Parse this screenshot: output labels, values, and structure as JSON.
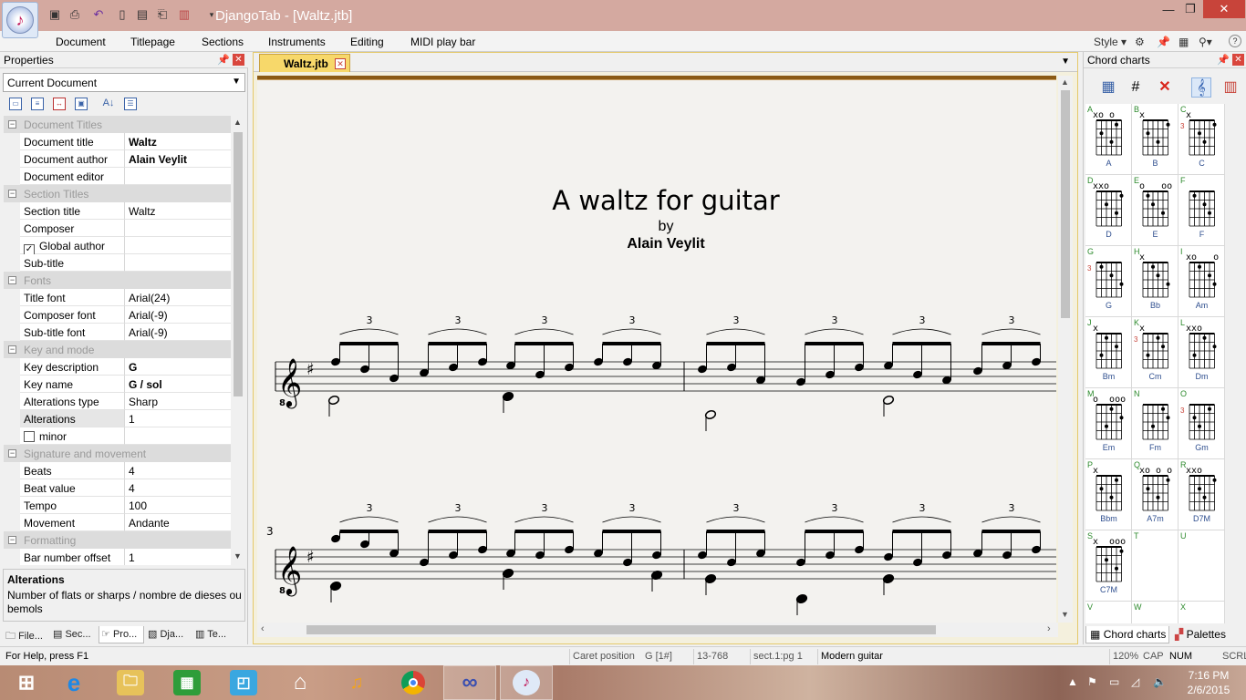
{
  "window": {
    "title": "DjangoTab - [Waltz.jtb]",
    "minimize": "—",
    "restore": "❐",
    "close": "✕"
  },
  "menu": {
    "items": [
      "Document",
      "Titlepage",
      "Sections",
      "Instruments",
      "Editing",
      "MIDI play bar"
    ],
    "style_label": "Style"
  },
  "properties": {
    "title": "Properties",
    "selector_value": "Current Document",
    "categories": {
      "document_titles": "Document Titles",
      "section_titles": "Section Titles",
      "fonts": "Fonts",
      "key_and_mode": "Key and mode",
      "signature": "Signature and movement",
      "formatting": "Formatting"
    },
    "rows": {
      "document_title": {
        "name": "Document title",
        "value": "Waltz"
      },
      "document_author": {
        "name": "Document author",
        "value": "Alain Veylit"
      },
      "document_editor": {
        "name": "Document editor",
        "value": ""
      },
      "section_title": {
        "name": "Section title",
        "value": "Waltz"
      },
      "composer": {
        "name": "Composer",
        "value": ""
      },
      "global_author": {
        "name": "Global author",
        "value": "",
        "checked": true
      },
      "sub_title": {
        "name": "Sub-title",
        "value": ""
      },
      "title_font": {
        "name": "Title font",
        "value": "Arial(24)"
      },
      "composer_font": {
        "name": "Composer font",
        "value": "Arial(-9)"
      },
      "sub_title_font": {
        "name": "Sub-title font",
        "value": "Arial(-9)"
      },
      "key_description": {
        "name": "Key description",
        "value": "G"
      },
      "key_name": {
        "name": "Key name",
        "value": "G / sol"
      },
      "alterations_type": {
        "name": "Alterations type",
        "value": "Sharp"
      },
      "alterations": {
        "name": "Alterations",
        "value": "1"
      },
      "minor": {
        "name": "minor",
        "value": "",
        "checked": false
      },
      "beats": {
        "name": "Beats",
        "value": "4"
      },
      "beat_value": {
        "name": "Beat value",
        "value": "4"
      },
      "tempo": {
        "name": "Tempo",
        "value": "100"
      },
      "movement": {
        "name": "Movement",
        "value": "Andante"
      },
      "bar_number_offset": {
        "name": "Bar number offset",
        "value": "1"
      }
    },
    "help": {
      "title": "Alterations",
      "text": "Number of flats or sharps / nombre de dieses ou bemols"
    },
    "bottom_tabs": [
      "File...",
      "Sec...",
      "Pro...",
      "Dja...",
      "Te..."
    ]
  },
  "document": {
    "tab_label": "Waltz.jtb",
    "score_title": "A waltz for guitar",
    "score_by": "by",
    "score_author": "Alain Veylit",
    "triplet_label": "3",
    "clef_octave": "8",
    "measure_number_2": "3"
  },
  "chords": {
    "title": "Chord charts",
    "cells": [
      {
        "letter": "A",
        "name": "A",
        "top": "xo o"
      },
      {
        "letter": "B",
        "name": "B",
        "top": "x"
      },
      {
        "letter": "C",
        "name": "C",
        "top": "x",
        "fret": "3"
      },
      {
        "letter": "D",
        "name": "D",
        "top": "xxo"
      },
      {
        "letter": "E",
        "name": "E",
        "top": "o   oo"
      },
      {
        "letter": "F",
        "name": "F",
        "top": ""
      },
      {
        "letter": "G",
        "name": "G",
        "top": "",
        "fret": "3"
      },
      {
        "letter": "H",
        "name": "Bb",
        "top": "x"
      },
      {
        "letter": "I",
        "name": "Am",
        "top": "xo   o"
      },
      {
        "letter": "J",
        "name": "Bm",
        "top": "x"
      },
      {
        "letter": "K",
        "name": "Cm",
        "top": "x",
        "fret": "3"
      },
      {
        "letter": "L",
        "name": "Dm",
        "top": "xxo"
      },
      {
        "letter": "M",
        "name": "Em",
        "top": "o  ooo"
      },
      {
        "letter": "N",
        "name": "Fm",
        "top": ""
      },
      {
        "letter": "O",
        "name": "Gm",
        "top": "",
        "fret": "3"
      },
      {
        "letter": "P",
        "name": "Bbm",
        "top": "x"
      },
      {
        "letter": "Q",
        "name": "A7m",
        "top": "xo o o"
      },
      {
        "letter": "R",
        "name": "D7M",
        "top": "xxo"
      },
      {
        "letter": "S",
        "name": "C7M",
        "top": "x  ooo"
      },
      {
        "letter": "T",
        "name": "",
        "top": ""
      },
      {
        "letter": "U",
        "name": "",
        "top": ""
      },
      {
        "letter": "V",
        "name": "",
        "top": ""
      },
      {
        "letter": "W",
        "name": "",
        "top": ""
      },
      {
        "letter": "X",
        "name": "",
        "top": ""
      }
    ],
    "bottom_tabs": [
      "Chord charts",
      "Palettes"
    ]
  },
  "status": {
    "help": "For Help, press F1",
    "caret_label": "Caret position",
    "caret_value": "G [1#]",
    "position": "13-768",
    "section": "sect.1:pg 1",
    "instrument": "Modern guitar",
    "zoom": "120%",
    "cap": "CAP",
    "num": "NUM",
    "scrl": "SCRL"
  },
  "taskbar": {
    "time": "7:16 PM",
    "date": "2/6/2015"
  },
  "colors": {
    "accent": "#f7d86a",
    "close": "#c8443a",
    "title_bar": "#d4a9a0"
  }
}
